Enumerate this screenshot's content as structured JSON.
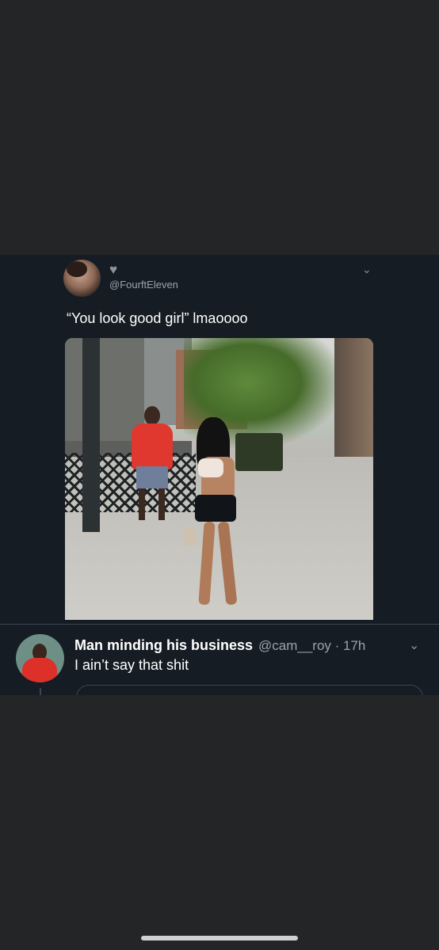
{
  "tweet": {
    "handle": "@FourftEleven",
    "text": "“You look good girl” lmaoooo",
    "heart_icon": "heart-icon",
    "menu_icon": "chevron-down-icon"
  },
  "reply": {
    "display_name": "Man minding his business",
    "meta": "@cam__roy · 17h",
    "text": "I ain’t say that shit",
    "menu_icon": "chevron-down-icon"
  },
  "colors": {
    "page_background": "#232527",
    "tweet_background": "#151c24",
    "primary_text": "#ffffff",
    "secondary_text": "#9aa3ab",
    "divider": "#3b4550"
  }
}
